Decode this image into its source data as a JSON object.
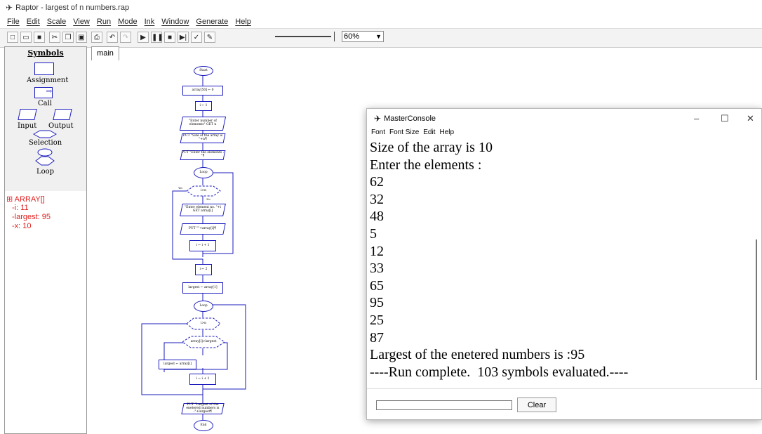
{
  "app": {
    "title": "Raptor - largest of n numbers.rap",
    "menu": [
      "File",
      "Edit",
      "Scale",
      "View",
      "Run",
      "Mode",
      "Ink",
      "Window",
      "Generate",
      "Help"
    ],
    "zoom": "60%",
    "toolbar_icons": [
      "new-icon",
      "open-icon",
      "save-icon",
      "cut-icon",
      "copy-icon",
      "paste-icon",
      "print-icon",
      "undo-icon",
      "redo-icon",
      "play-icon",
      "pause-icon",
      "stop-icon",
      "step-icon",
      "test-icon",
      "pen-icon"
    ]
  },
  "symbols": {
    "heading": "Symbols",
    "assignment": "Assignment",
    "call": "Call",
    "input": "Input",
    "output": "Output",
    "selection": "Selection",
    "loop": "Loop"
  },
  "variables": [
    {
      "text": "⊞ ARRAY[]"
    },
    {
      "text": "-i: 11"
    },
    {
      "text": "-largest: 95"
    },
    {
      "text": "-x: 10"
    }
  ],
  "tab": "main",
  "flowchart": {
    "start": "Start",
    "n1": "array[50] ← 0",
    "n2": "i ← 1",
    "n3": "\"Enter number of elements\" GET n",
    "n4": "PUT \"Size of the array is \"+n¶",
    "n5": "PUT \"Enter the elements : \"¶",
    "loop1": "Loop",
    "cond1": "i>n",
    "n6": "\"Enter element no. \"+i GET array[i]",
    "n7": "PUT \"\"+array[i]¶",
    "n8": "i ← i + 1",
    "n9": "i ← 2",
    "n10": "largest ← array[1]",
    "loop2": "Loop",
    "cond2": "i>n",
    "cond3": "array[i]>largest",
    "n11": "largest ← array[i]",
    "n12": "i ← i + 1",
    "n13": "PUT \"Largest of the enetered numbers is :\"+largest¶",
    "end": "End",
    "yes": "Yes",
    "no": "No"
  },
  "console": {
    "title": "MasterConsole",
    "menu": [
      "Font",
      "Font Size",
      "Edit",
      "Help"
    ],
    "lines": [
      "Size of the array is 10",
      "Enter the elements :",
      "62",
      "32",
      "48",
      "5",
      "12",
      "33",
      "65",
      "95",
      "25",
      "87",
      "Largest of the enetered numbers is :95",
      "----Run complete.  103 symbols evaluated.----"
    ],
    "clear_label": "Clear",
    "input_value": ""
  }
}
